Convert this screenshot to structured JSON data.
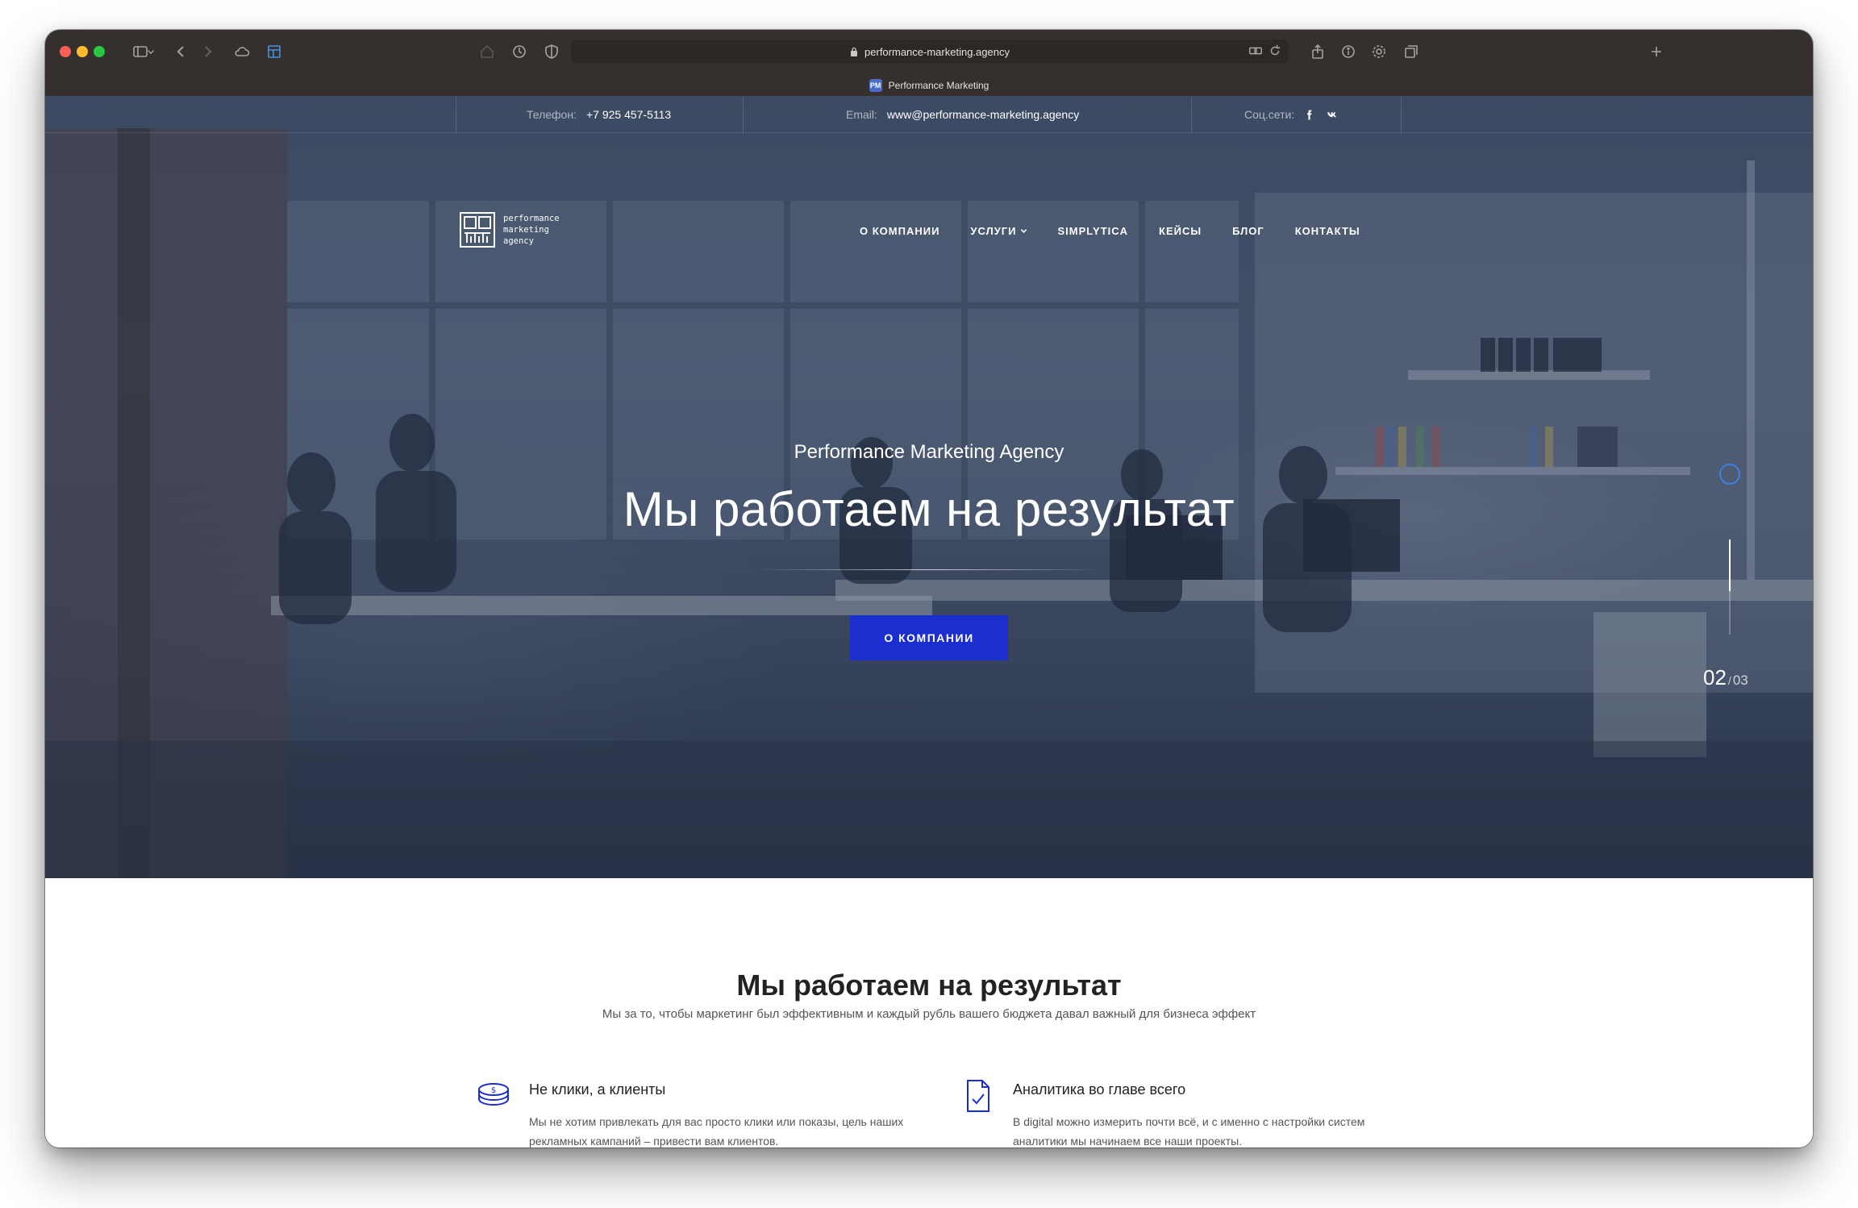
{
  "browser": {
    "url": "performance-marketing.agency",
    "tab_title": "Performance Marketing",
    "favicon_text": "PM"
  },
  "topbar": {
    "phone_label": "Телефон:",
    "phone_value": "+7 925 457-5113",
    "email_label": "Email:",
    "email_value": "www@performance-marketing.agency",
    "social_label": "Соц.сети:"
  },
  "logo": {
    "line1": "performance",
    "line2": "marketing",
    "line3": "agency"
  },
  "nav": {
    "items": [
      "О КОМПАНИИ",
      "УСЛУГИ",
      "SIMPLYTICA",
      "КЕЙСЫ",
      "БЛОГ",
      "КОНТАКТЫ"
    ]
  },
  "hero": {
    "subtitle": "Performance Marketing Agency",
    "title": "Мы работаем на результат",
    "button": "О КОМПАНИИ",
    "slide_current": "02",
    "slide_separator": "/",
    "slide_total": "03",
    "slide_progress": 0.54
  },
  "section": {
    "title": "Мы работаем на результат",
    "subtitle": "Мы за то, чтобы маркетинг был эффективным и каждый рубль вашего бюджета давал важный для бизнеса эффект",
    "features": [
      {
        "icon": "coins-icon",
        "title": "Не клики, а клиенты",
        "text": "Мы не хотим привлекать для вас просто клики или показы, цель наших рекламных кампаний – привести вам клиентов."
      },
      {
        "icon": "document-check-icon",
        "title": "Аналитика во главе всего",
        "text": "В digital можно измерить почти всё, и с именно с настройки систем аналитики мы начинаем все наши проекты."
      }
    ]
  },
  "colors": {
    "accent": "#1b2fd0",
    "toolbar": "#35302d"
  }
}
